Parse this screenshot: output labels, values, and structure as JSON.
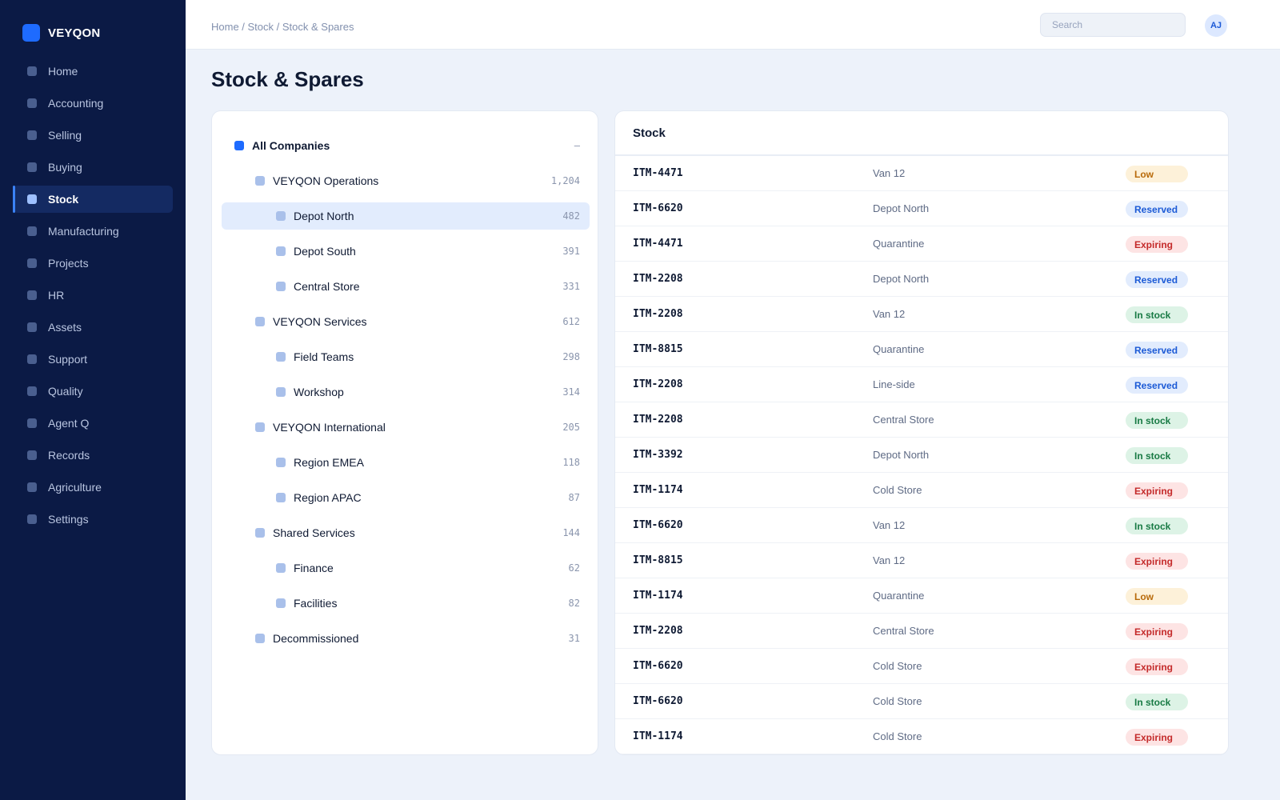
{
  "brand": {
    "name": "VEYQON",
    "accent": "#1e6bff"
  },
  "sidebar": {
    "items": [
      {
        "label": "Home"
      },
      {
        "label": "Accounting"
      },
      {
        "label": "Selling"
      },
      {
        "label": "Buying"
      },
      {
        "label": "Stock",
        "active": true
      },
      {
        "label": "Manufacturing"
      },
      {
        "label": "Projects"
      },
      {
        "label": "HR"
      },
      {
        "label": "Assets"
      },
      {
        "label": "Support"
      },
      {
        "label": "Quality"
      },
      {
        "label": "Agent Q"
      },
      {
        "label": "Records"
      },
      {
        "label": "Agriculture"
      },
      {
        "label": "Settings"
      }
    ]
  },
  "topbar": {
    "breadcrumb": "Home / Stock / Stock & Spares",
    "search_placeholder": "Search",
    "avatar_initials": "AJ"
  },
  "page": {
    "title": "Stock & Spares"
  },
  "tree": {
    "nodes": [
      {
        "label": "All Companies",
        "count": "–",
        "root": true
      },
      {
        "label": "VEYQON Operations",
        "count": "1,204"
      },
      {
        "label": "Depot North",
        "count": "482",
        "selected": true
      },
      {
        "label": "Depot South",
        "count": "391"
      },
      {
        "label": "Central Store",
        "count": "331"
      },
      {
        "label": "VEYQON Services",
        "count": "612"
      },
      {
        "label": "Field Teams",
        "count": "298"
      },
      {
        "label": "Workshop",
        "count": "314"
      },
      {
        "label": "VEYQON International",
        "count": "205"
      },
      {
        "label": "Region EMEA",
        "count": "118"
      },
      {
        "label": "Region APAC",
        "count": "87"
      },
      {
        "label": "Shared Services",
        "count": "144"
      },
      {
        "label": "Finance",
        "count": "62"
      },
      {
        "label": "Facilities",
        "count": "82"
      },
      {
        "label": "Decommissioned",
        "count": "31"
      }
    ]
  },
  "stock": {
    "title": "Stock",
    "rows": [
      {
        "item": "ITM-4471",
        "location": "Van 12",
        "status": "Low"
      },
      {
        "item": "ITM-6620",
        "location": "Depot North",
        "status": "Reserved"
      },
      {
        "item": "ITM-4471",
        "location": "Quarantine",
        "status": "Expiring"
      },
      {
        "item": "ITM-2208",
        "location": "Depot North",
        "status": "Reserved"
      },
      {
        "item": "ITM-2208",
        "location": "Van 12",
        "status": "In stock"
      },
      {
        "item": "ITM-8815",
        "location": "Quarantine",
        "status": "Reserved"
      },
      {
        "item": "ITM-2208",
        "location": "Line-side",
        "status": "Reserved"
      },
      {
        "item": "ITM-2208",
        "location": "Central Store",
        "status": "In stock"
      },
      {
        "item": "ITM-3392",
        "location": "Depot North",
        "status": "In stock"
      },
      {
        "item": "ITM-1174",
        "location": "Cold Store",
        "status": "Expiring"
      },
      {
        "item": "ITM-6620",
        "location": "Van 12",
        "status": "In stock"
      },
      {
        "item": "ITM-8815",
        "location": "Van 12",
        "status": "Expiring"
      },
      {
        "item": "ITM-1174",
        "location": "Quarantine",
        "status": "Low"
      },
      {
        "item": "ITM-2208",
        "location": "Central Store",
        "status": "Expiring"
      },
      {
        "item": "ITM-6620",
        "location": "Cold Store",
        "status": "Expiring"
      },
      {
        "item": "ITM-6620",
        "location": "Cold Store",
        "status": "In stock"
      },
      {
        "item": "ITM-1174",
        "location": "Cold Store",
        "status": "Expiring"
      }
    ]
  },
  "status_colors": {
    "Low": "#b86a0a",
    "Reserved": "#1c5ad6",
    "Expiring": "#c42a2a",
    "In stock": "#187a44"
  }
}
